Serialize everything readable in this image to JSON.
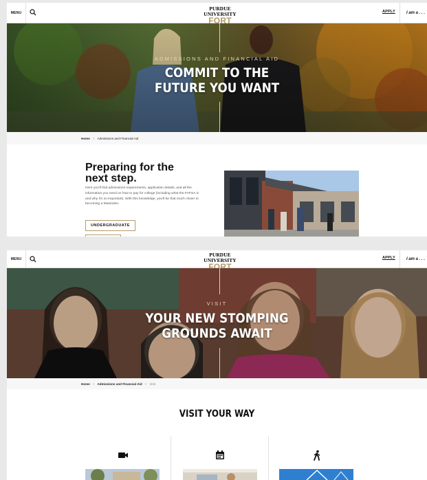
{
  "header": {
    "menu_label": "MENU",
    "logo_top": "PURDUE UNIVERSITY",
    "logo_bottom": "FORT WAYNE",
    "apply_label": "APPLY",
    "iam_label": "I am a . . ."
  },
  "admissions_page": {
    "hero": {
      "eyebrow": "ADMISSIONS AND FINANCIAL AID",
      "headline_line1": "COMMIT TO THE",
      "headline_line2": "FUTURE YOU WANT"
    },
    "breadcrumb": [
      "Home",
      "Admissions and Financial Aid"
    ],
    "section": {
      "title_line1": "Preparing for the",
      "title_line2": "next step.",
      "body": "Here you'll find admissions requirements, application details, and all the information you need on how to pay for college (including what the FAFSA is and why it's so important). With this knowledge, you'll be that much closer to becoming a Mastodon.",
      "button_label": "UNDERGRADUATE"
    }
  },
  "visit_page": {
    "hero": {
      "eyebrow": "VISIT",
      "headline_line1": "YOUR NEW STOMPING",
      "headline_line2": "GROUNDS AWAIT"
    },
    "breadcrumb": [
      "Home",
      "Admissions and Financial Aid",
      "Visit"
    ],
    "section_title": "VISIT YOUR WAY",
    "cards": [
      {
        "icon": "video-camera-icon"
      },
      {
        "icon": "calendar-icon"
      },
      {
        "icon": "walking-person-icon"
      }
    ]
  },
  "colors": {
    "gold": "#b39b6a",
    "eyebrow_gold": "#e8d9b0",
    "text_dark": "#111111"
  }
}
